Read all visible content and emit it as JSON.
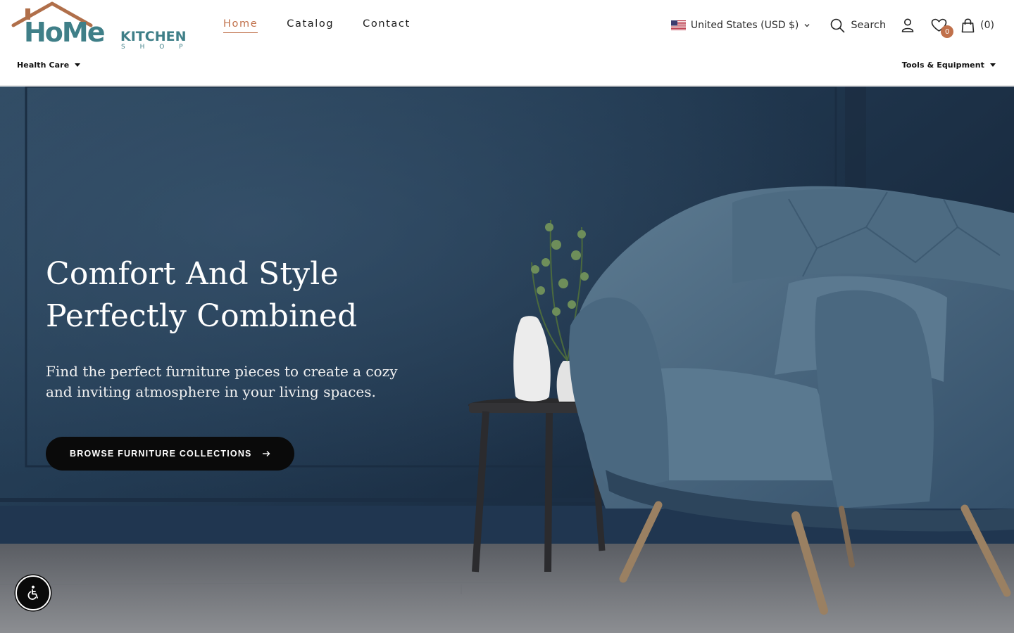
{
  "logo": {
    "word": "HoMe",
    "kitchen": "KITCHEN",
    "shop": "S H O P",
    "colors": {
      "teal": "#3f7f88",
      "roof": "#b06f4a"
    }
  },
  "nav": {
    "items": [
      {
        "label": "Home",
        "active": true
      },
      {
        "label": "Catalog",
        "active": false
      },
      {
        "label": "Contact",
        "active": false
      }
    ]
  },
  "utils": {
    "currency": "United States (USD $)",
    "search_label": "Search",
    "wishlist_count": "0",
    "cart_count": "(0)"
  },
  "sub_nav": {
    "left": "Health Care",
    "right": "Tools & Equipment"
  },
  "hero": {
    "title_line1": "Comfort And Style",
    "title_line2": "Perfectly Combined",
    "subtitle": "Find the perfect furniture pieces to create a cozy and inviting atmosphere in your living spaces.",
    "cta": "BROWSE FURNITURE COLLECTIONS"
  },
  "icons": {
    "flag": "us-flag-icon",
    "search": "search-icon",
    "account": "user-icon",
    "wishlist": "heart-icon",
    "cart": "shopping-bag-icon",
    "accessibility": "accessibility-icon"
  },
  "colors": {
    "accent": "#c0704a",
    "hero_wall": "#22384f",
    "button": "#0a0a0a"
  }
}
